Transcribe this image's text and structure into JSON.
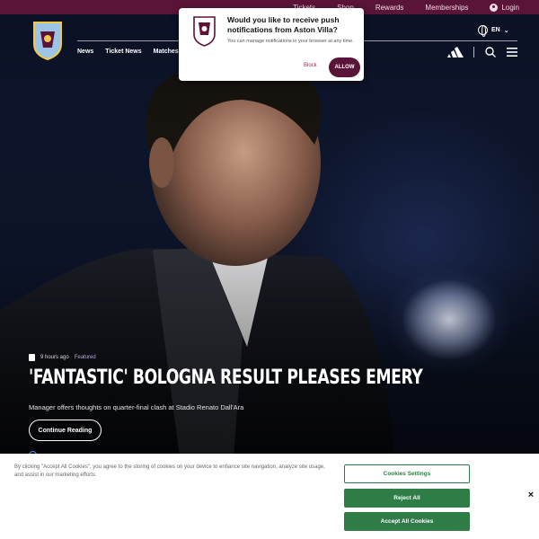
{
  "utility": {
    "links": [
      "Tickets",
      "Shop",
      "Rewards",
      "Memberships"
    ],
    "login": "Login"
  },
  "header": {
    "nav": [
      "News",
      "Ticket News",
      "Matches"
    ],
    "language": "EN",
    "icons": [
      "club-crest-icon",
      "globe-icon",
      "chevron-down-icon",
      "adidas-logo-icon",
      "search-icon",
      "menu-icon"
    ]
  },
  "article": {
    "time": "9 hours ago",
    "tag": "Featured",
    "headline": "'Fantastic' Bologna result pleases Emery",
    "subtitle": "Manager offers thoughts on quarter-final clash at Stadio Renato Dall'Ara",
    "cta": "Continue Reading"
  },
  "notification": {
    "title": "Would you like to receive push notifications from Aston Villa?",
    "body": "You can manage notifications in your browser at any time.",
    "block": "Block",
    "allow": "ALLOW"
  },
  "cookies": {
    "text": "By clicking \"Accept All Cookies\", you agree to the storing of cookies on your device to enhance site navigation, analyze site usage, and assist in our marketing efforts.",
    "settings": "Cookies Settings",
    "reject": "Reject All",
    "accept": "Accept All Cookies",
    "close": "×"
  },
  "colors": {
    "claret": "#5a1437",
    "cookie_green": "#2e7d46",
    "hero_bg": "#0c1428",
    "tag_purple": "#b9a3d8"
  }
}
